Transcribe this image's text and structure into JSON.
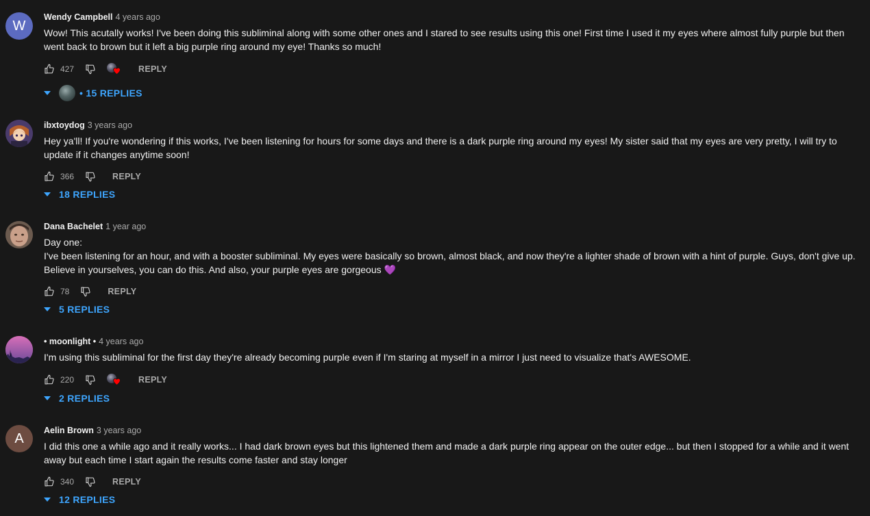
{
  "comments": [
    {
      "author": "Wendy Campbell",
      "time": "4 years ago",
      "avatar_letter": "W",
      "avatar_color": "#5c6bc0",
      "text": "Wow! This acutally works! I've been doing this subliminal along with some other ones and I stared to see results using this one! First time I used it my eyes where almost fully purple but then went back to brown but it left a big purple ring around my eye! Thanks so much!",
      "likes": "427",
      "reply_label": "REPLY",
      "replies_label": "• 15 REPLIES"
    },
    {
      "author": "ibxtoydog",
      "time": "3 years ago",
      "text": "Hey ya'll! If you're wondering if this works, I've been listening for hours for some days and there is a dark purple ring around my eyes! My sister said that my eyes are very pretty, I will try to update if it changes anytime soon!",
      "likes": "366",
      "reply_label": "REPLY",
      "replies_label": "18 REPLIES"
    },
    {
      "author": "Dana Bachelet",
      "time": "1 year ago",
      "text_lines": [
        "Day one:",
        "I've been listening for an hour, and with a booster subliminal. My eyes were basically so brown, almost black, and now they're a lighter shade of brown with a hint of purple. Guys, don't give up. Believe in yourselves, you can do this. And also, your purple eyes are gorgeous 💜"
      ],
      "likes": "78",
      "reply_label": "REPLY",
      "replies_label": "5 REPLIES"
    },
    {
      "author": "• moonlight •",
      "time": "4 years ago",
      "text": "I'm using this subliminal for the first day they're already becoming purple even if I'm staring at myself in a mirror I just need to visualize that's AWESOME.",
      "likes": "220",
      "reply_label": "REPLY",
      "replies_label": "2 REPLIES"
    },
    {
      "author": "Aelin Brown",
      "time": "3 years ago",
      "avatar_letter": "A",
      "avatar_color": "#6d4c41",
      "text": "I did this one a while ago and it really works... I had dark brown eyes but this lightened them and made a dark purple ring appear on the outer edge... but then I stopped for a while and it went away but each time I start again the results come faster and stay longer",
      "likes": "340",
      "reply_label": "REPLY",
      "replies_label": "12 REPLIES"
    }
  ],
  "colors": {
    "background": "#181818",
    "link_blue": "#3ea6ff",
    "secondary_text": "#aaaaaa",
    "heart_red": "#ff0000"
  },
  "icons": {
    "like": "thumbs-up-icon",
    "dislike": "thumbs-down-icon",
    "creator_heart": "creator-heart-icon",
    "expand": "caret-down-icon"
  }
}
